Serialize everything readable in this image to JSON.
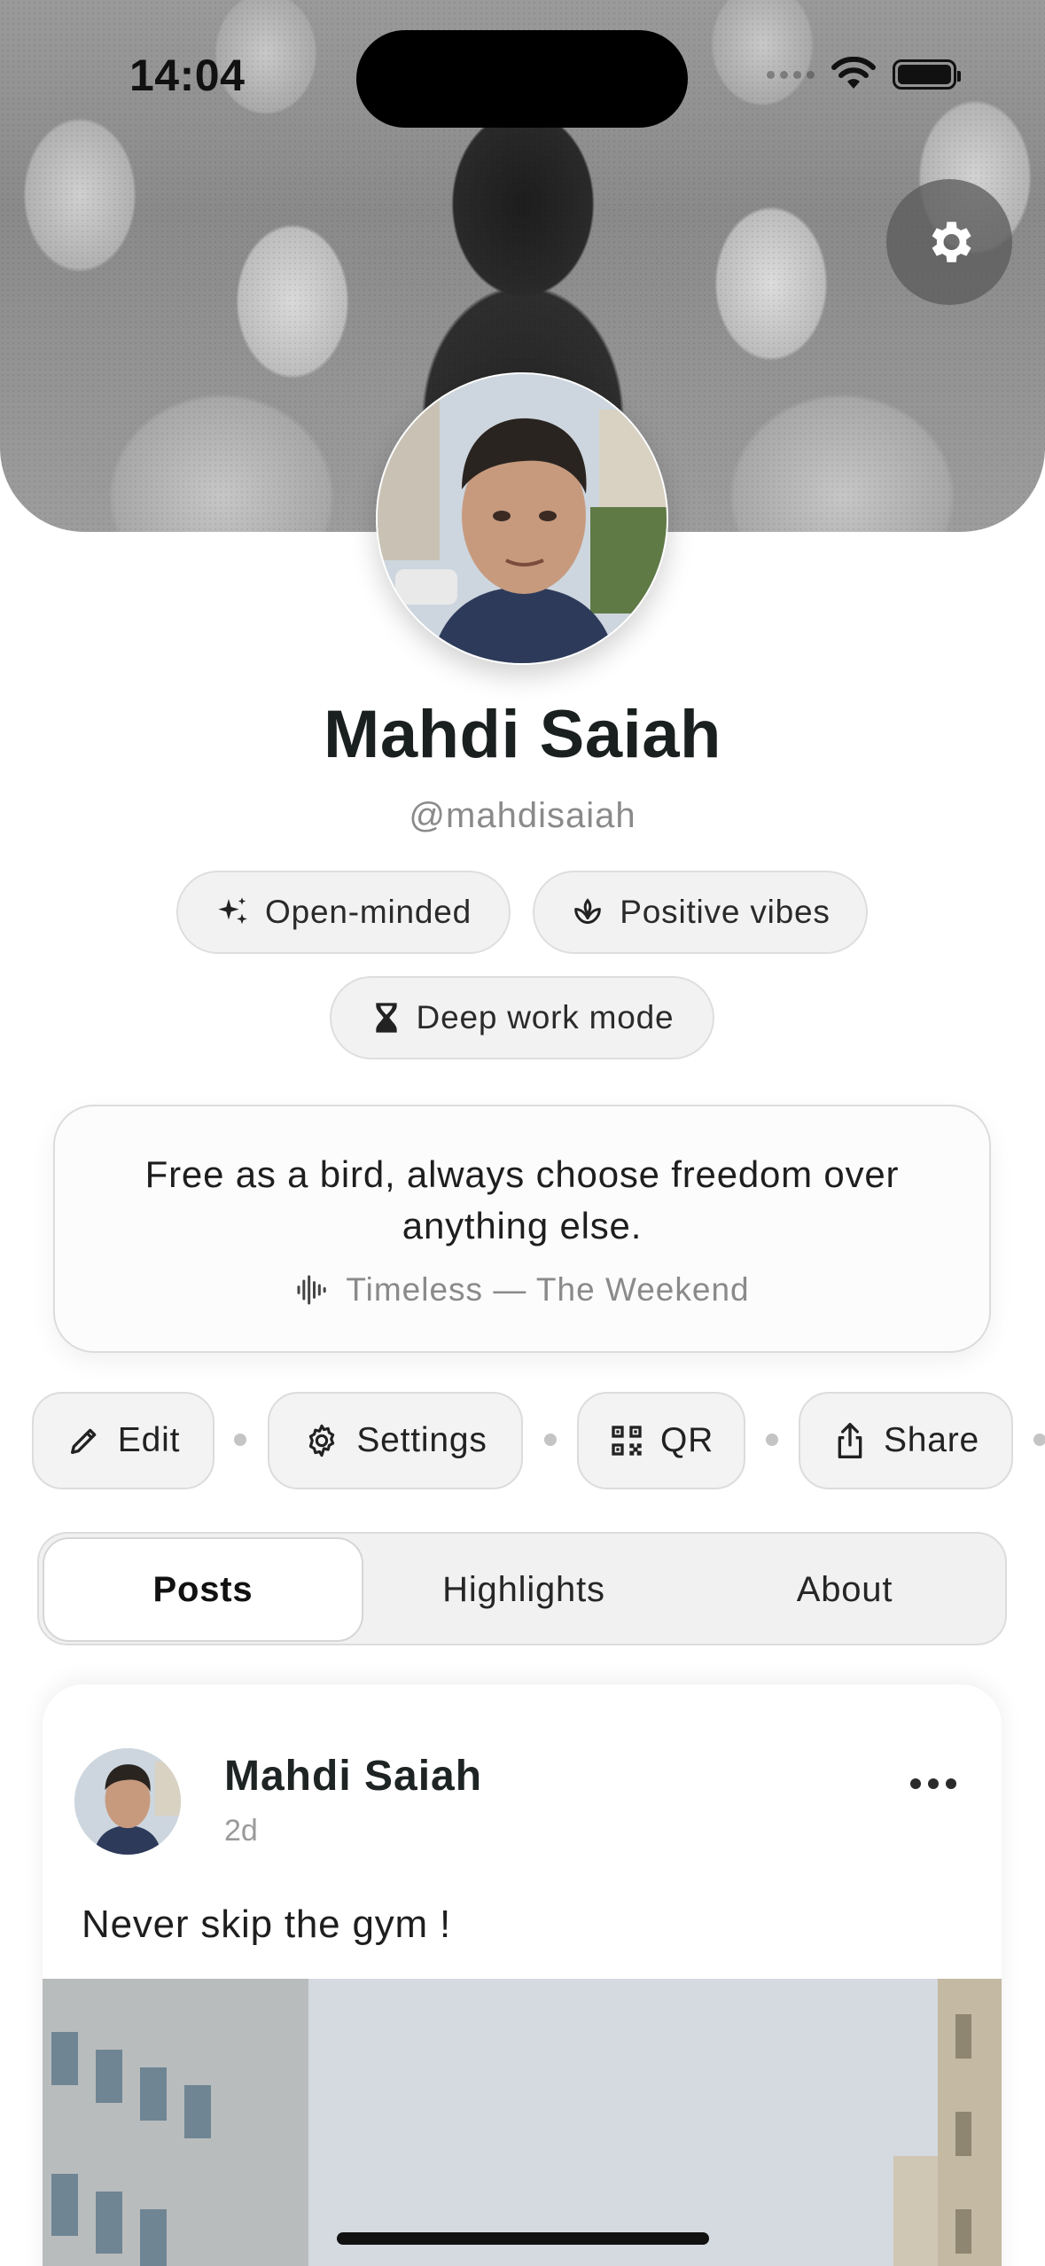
{
  "status_bar": {
    "time": "14:04"
  },
  "profile": {
    "name": "Mahdi Saiah",
    "handle": "@mahdisaiah",
    "chips": [
      {
        "label": "Open-minded",
        "icon": "sparkles-icon"
      },
      {
        "label": "Positive vibes",
        "icon": "lotus-icon"
      },
      {
        "label": "Deep work mode",
        "icon": "hourglass-icon"
      }
    ],
    "bio": {
      "text": "Free as a bird, always choose freedom over anything else.",
      "song": "Timeless — The Weekend",
      "song_icon": "waveform-icon"
    }
  },
  "actions": [
    {
      "label": "Edit",
      "icon": "pencil-icon"
    },
    {
      "label": "Settings",
      "icon": "gear-icon"
    },
    {
      "label": "QR",
      "icon": "qr-code-icon"
    },
    {
      "label": "Share",
      "icon": "share-icon"
    }
  ],
  "tabs": [
    {
      "label": "Posts",
      "active": true
    },
    {
      "label": "Highlights",
      "active": false
    },
    {
      "label": "About",
      "active": false
    }
  ],
  "post": {
    "author": "Mahdi Saiah",
    "time": "2d",
    "text": "Never skip the gym !"
  }
}
